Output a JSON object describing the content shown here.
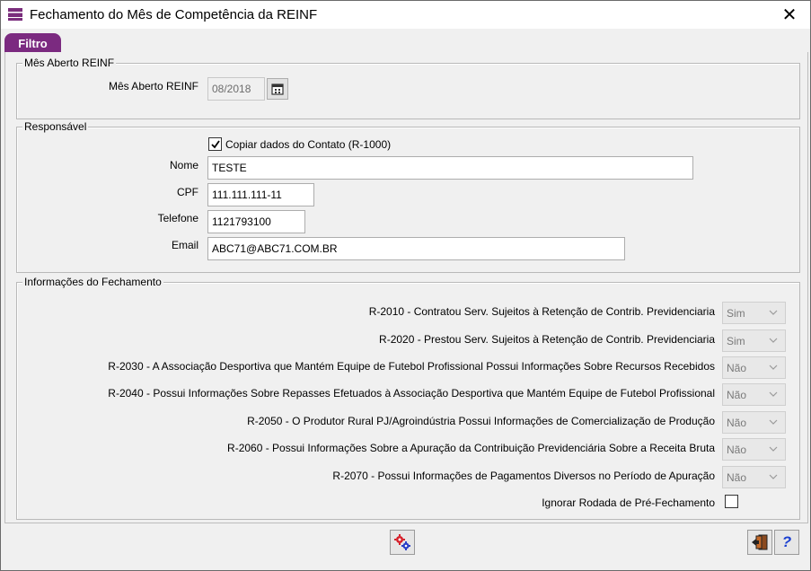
{
  "window": {
    "title": "Fechamento do Mês de Competência da REINF",
    "close_glyph": "✕"
  },
  "tabs": [
    {
      "label": "Filtro",
      "active": true
    }
  ],
  "mes_aberto": {
    "group_title": "Mês Aberto REINF",
    "label": "Mês Aberto REINF",
    "value": "08/2018",
    "enabled": false
  },
  "responsavel": {
    "group_title": "Responsável",
    "copy_checkbox_label": "Copiar dados do Contato (R-1000)",
    "copy_checked": true,
    "nome_label": "Nome",
    "nome_value": "TESTE",
    "cpf_label": "CPF",
    "cpf_value": "111.111.111-11",
    "telefone_label": "Telefone",
    "telefone_value": "1121793100",
    "email_label": "Email",
    "email_value": "ABC71@ABC71.COM.BR"
  },
  "fechamento": {
    "group_title": "Informações do Fechamento",
    "rows": [
      {
        "label": "R-2010 - Contratou Serv. Sujeitos à Retenção de Contrib. Previdenciaria",
        "value": "Sim"
      },
      {
        "label": "R-2020 - Prestou Serv. Sujeitos à Retenção de Contrib. Previdenciaria",
        "value": "Sim"
      },
      {
        "label": "R-2030 - A Associação Desportiva que Mantém Equipe de Futebol Profissional Possui Informações Sobre Recursos Recebidos",
        "value": "Não"
      },
      {
        "label": "R-2040 - Possui Informações Sobre Repasses Efetuados à Associação Desportiva que Mantém Equipe de Futebol Profissional",
        "value": "Não"
      },
      {
        "label": "R-2050 - O Produtor Rural PJ/Agroindústria Possui Informações de Comercialização de Produção",
        "value": "Não"
      },
      {
        "label": "R-2060 - Possui Informações Sobre a Apuração da Contribuição Previdenciária Sobre a Receita Bruta",
        "value": "Não"
      },
      {
        "label": "R-2070 - Possui Informações de Pagamentos Diversos no Período de Apuração",
        "value": "Não"
      }
    ],
    "ignorar_label": "Ignorar Rodada de Pré-Fechamento",
    "ignorar_checked": false
  },
  "footer": {
    "help_glyph": "?"
  },
  "colors": {
    "accent": "#7b2a80",
    "help_blue": "#1a3fd1",
    "gear_red": "#d6202a",
    "gear_blue": "#2a3fc8"
  },
  "icons": [
    "app-icon",
    "calendar-icon",
    "execute-gears-icon",
    "exit-door-icon",
    "help-icon"
  ]
}
